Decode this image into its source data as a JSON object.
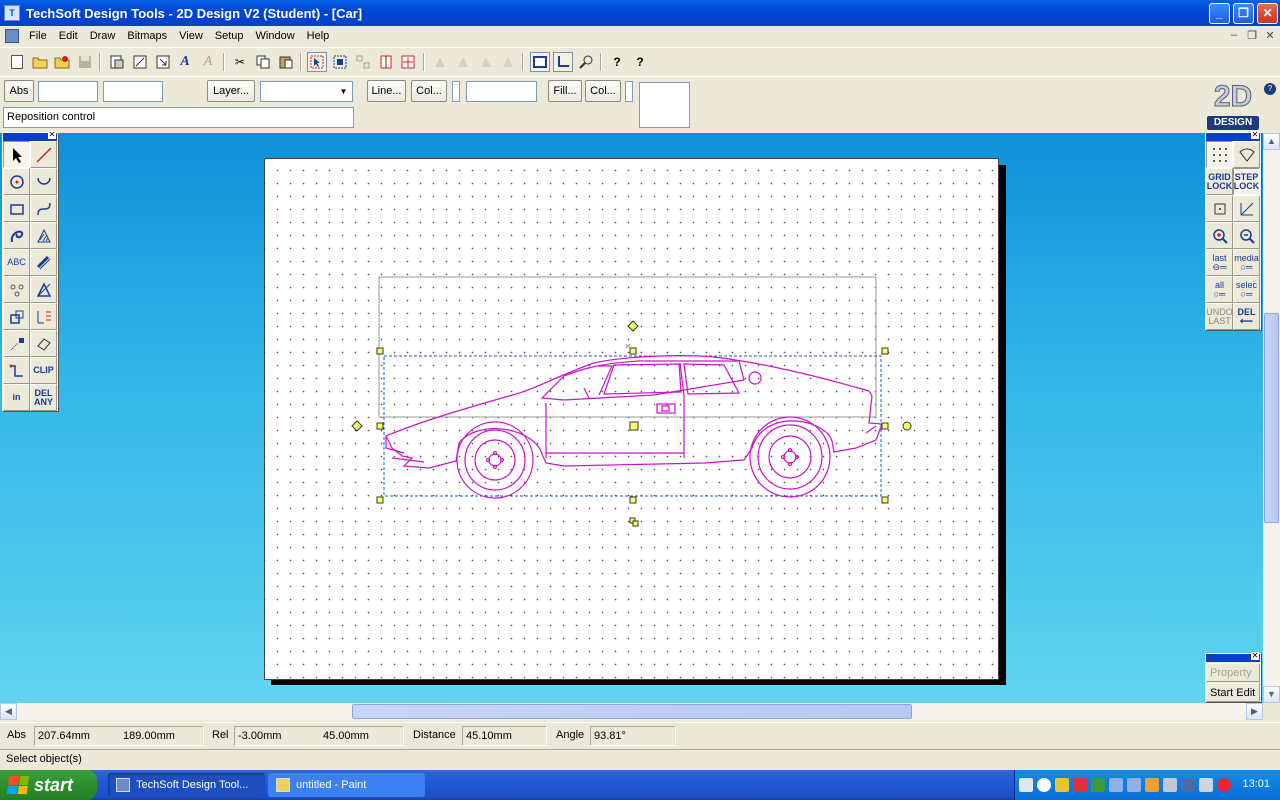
{
  "window": {
    "title": "TechSoft Design Tools - 2D Design V2 (Student) - [Car]",
    "minimize": "_",
    "maximize": "❐",
    "close": "✕"
  },
  "menu": [
    "File",
    "Edit",
    "Draw",
    "Bitmaps",
    "View",
    "Setup",
    "Window",
    "Help"
  ],
  "props": {
    "abs_button": "Abs",
    "layer_button": "Layer...",
    "line_button": "Line...",
    "line_col_button": "Col...",
    "fill_button": "Fill...",
    "fill_col_button": "Col...",
    "prompt": "Reposition control"
  },
  "logo": {
    "big": "2D",
    "tag": "DESIGN",
    "help": "?"
  },
  "left_palette": {
    "labels": {
      "text": "ABC",
      "clip": "CLIP",
      "in": "in",
      "del_any_1": "DEL",
      "del_any_2": "ANY"
    }
  },
  "right_palette": {
    "grid_lock": [
      "GRID",
      "LOCK"
    ],
    "step_lock": [
      "STEP",
      "LOCK"
    ],
    "last": "last",
    "media": "media",
    "all": "all",
    "select": "selec",
    "undo_last": [
      "UNDO",
      "LAST"
    ],
    "del": "DEL"
  },
  "property_panel": {
    "property": "Property",
    "start_edit": "Start Edit"
  },
  "coords": {
    "abs_label": "Abs",
    "abs_x": "207.64mm",
    "abs_y": "189.00mm",
    "rel_label": "Rel",
    "rel_x": "-3.00mm",
    "rel_y": "45.00mm",
    "distance_label": "Distance",
    "distance": "45.10mm",
    "angle_label": "Angle",
    "angle": "93.81°"
  },
  "status": "Select object(s)",
  "taskbar": {
    "start": "start",
    "tasks": [
      "TechSoft Design Tool...",
      "untitled - Paint"
    ],
    "clock": "13:01"
  },
  "colors": {
    "drawing": "#cc11cc",
    "handle": "#ffff66",
    "selection": "#2255cc"
  }
}
